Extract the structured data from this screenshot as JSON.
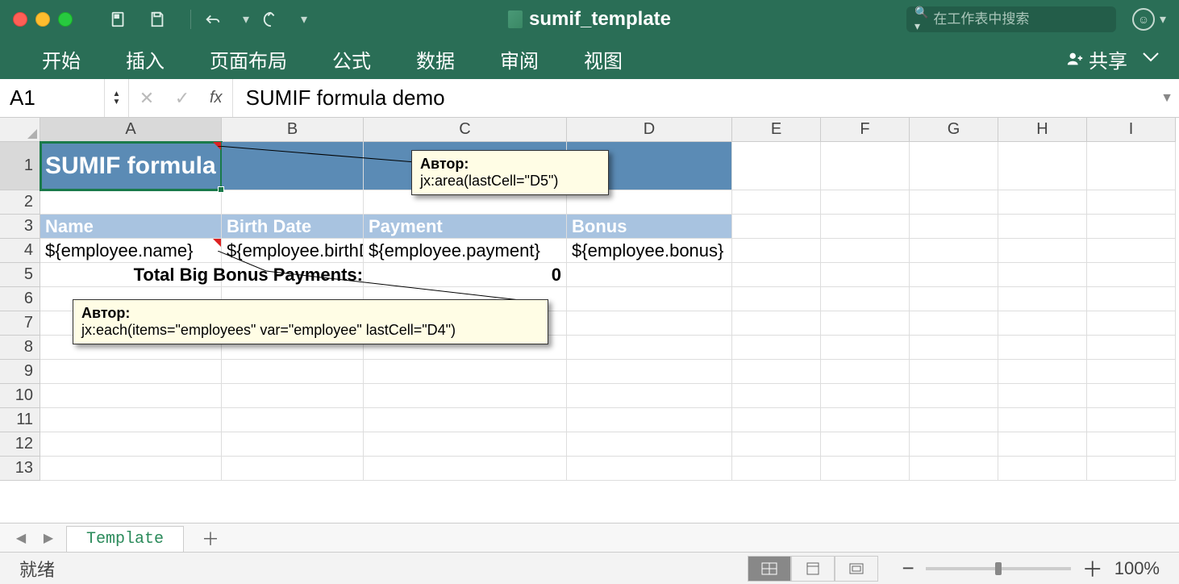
{
  "titlebar": {
    "doc_name": "sumif_template",
    "search_placeholder": "在工作表中搜索"
  },
  "ribbon": {
    "tabs": [
      "开始",
      "插入",
      "页面布局",
      "公式",
      "数据",
      "审阅",
      "视图"
    ],
    "share_label": "共享"
  },
  "formula_bar": {
    "cell_ref": "A1",
    "fx_label": "fx",
    "formula": "SUMIF formula demo"
  },
  "columns": [
    "A",
    "B",
    "C",
    "D",
    "E",
    "F",
    "G",
    "H",
    "I"
  ],
  "rows_visible": 13,
  "sheet": {
    "title_row": {
      "text": "SUMIF formula demo"
    },
    "headers": {
      "A": "Name",
      "B": "Birth Date",
      "C": "Payment",
      "D": "Bonus"
    },
    "data_row": {
      "A": "${employee.name}",
      "B": "${employee.birthDate}",
      "C": "${employee.payment}",
      "D": "${employee.bonus}"
    },
    "totals": {
      "label": "Total Big Bonus Payments:",
      "value": "0"
    }
  },
  "comments": {
    "area": {
      "author": "Автор:",
      "text": "jx:area(lastCell=\"D5\")"
    },
    "each": {
      "author": "Автор:",
      "text": "jx:each(items=\"employees\" var=\"employee\" lastCell=\"D4\")"
    }
  },
  "sheet_tabs": {
    "active": "Template"
  },
  "status": {
    "ready": "就绪",
    "zoom": "100%"
  }
}
